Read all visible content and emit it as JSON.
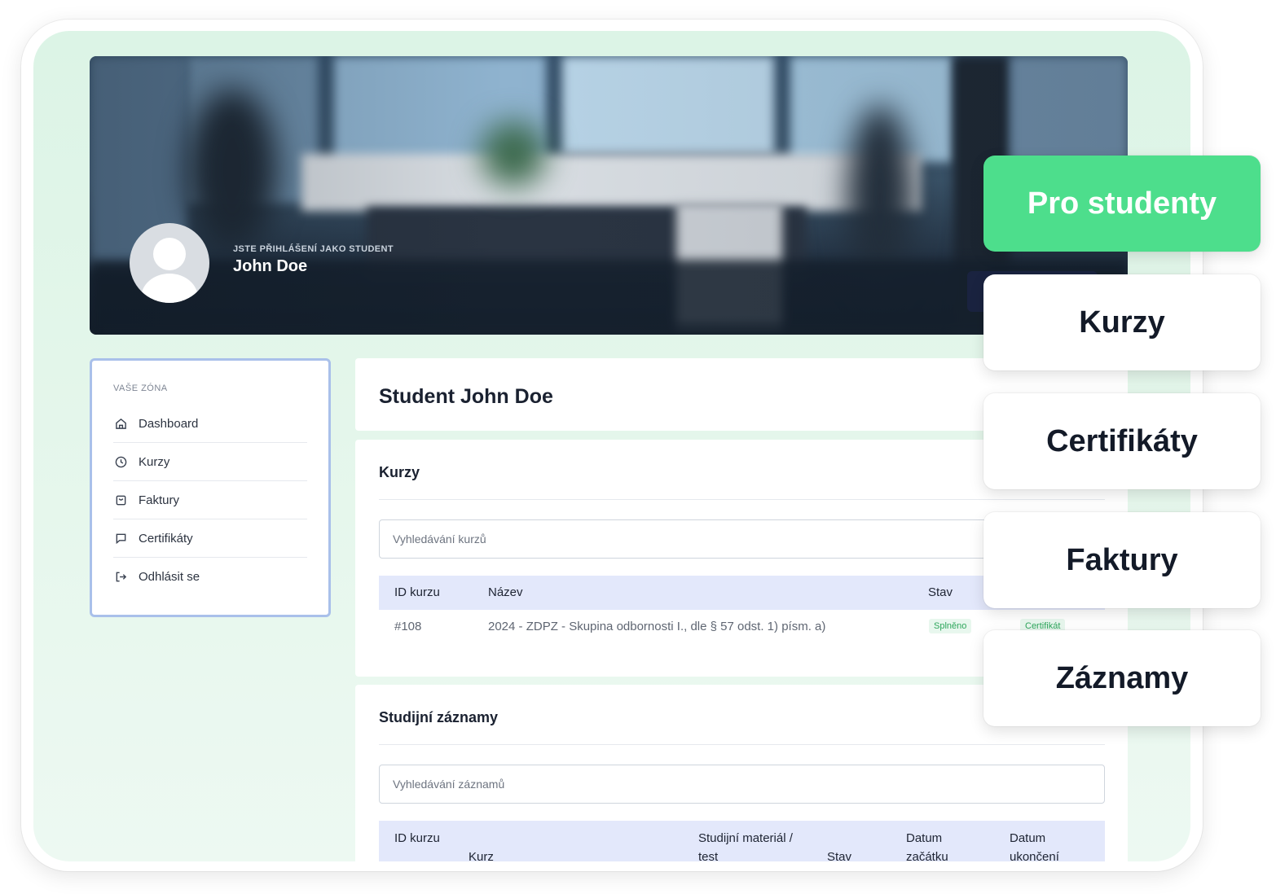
{
  "hero": {
    "subtitle": "JSTE PŘIHLÁŠENÍ JAKO STUDENT",
    "name": "John Doe"
  },
  "sidebar": {
    "label": "VAŠE ZÓNA",
    "items": [
      {
        "label": "Dashboard",
        "icon": "home-icon"
      },
      {
        "label": "Kurzy",
        "icon": "clock-icon"
      },
      {
        "label": "Faktury",
        "icon": "bag-icon"
      },
      {
        "label": "Certifikáty",
        "icon": "message-icon"
      },
      {
        "label": "Odhlásit se",
        "icon": "logout-icon"
      }
    ]
  },
  "main": {
    "title": "Student John Doe",
    "courses": {
      "title": "Kurzy",
      "search_placeholder": "Vyhledávání kurzů",
      "columns": [
        "ID kurzu",
        "Název",
        "Stav"
      ],
      "rows": [
        {
          "id": "#108",
          "name": "2024 - ZDPZ - Skupina odbornosti I., dle § 57 odst. 1) písm. a)",
          "status": "Splněno",
          "certificate": "Certifikát"
        }
      ]
    },
    "records": {
      "title": "Studijní záznamy",
      "search_placeholder": "Vyhledávání záznamů",
      "columns": [
        "ID kurzu",
        "Kurz",
        "Studijní materiál / test",
        "Stav",
        "Datum začátku",
        "Datum ukončení"
      ]
    }
  },
  "cards": [
    {
      "label": "Pro studenty",
      "accent": true
    },
    {
      "label": "Kurzy",
      "accent": false
    },
    {
      "label": "Certifikáty",
      "accent": false
    },
    {
      "label": "Faktury",
      "accent": false
    },
    {
      "label": "Záznamy",
      "accent": false
    }
  ],
  "colors": {
    "accent_green": "#4dde8c",
    "table_header": "#e3e8fb",
    "badge_green": "#2ea65c",
    "sidebar_border": "#a9c0ea"
  }
}
